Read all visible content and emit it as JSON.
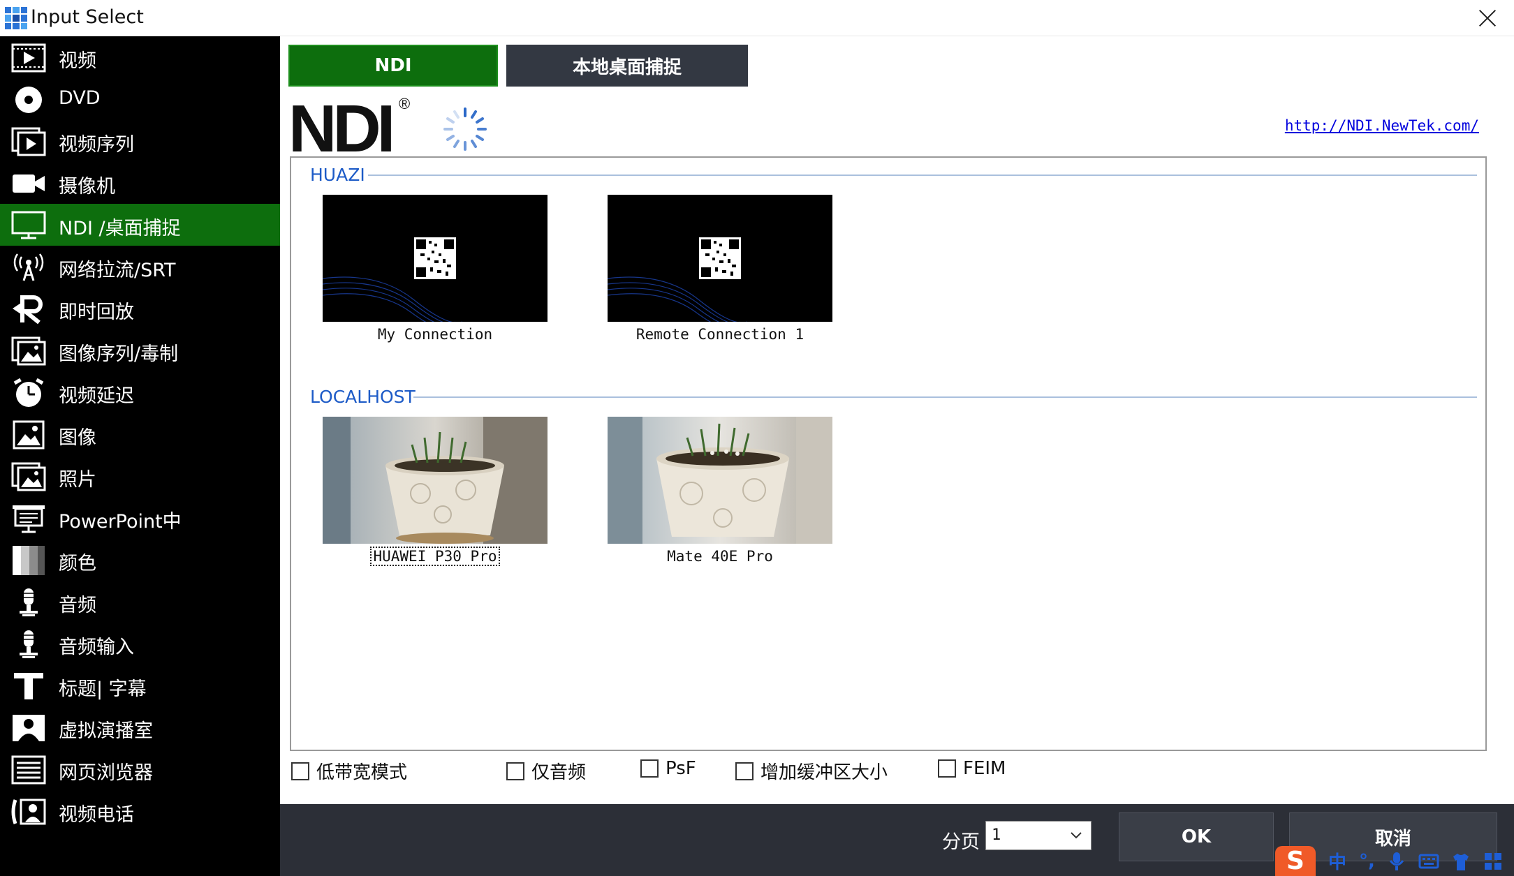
{
  "window": {
    "title": "Input Select"
  },
  "sidebar": {
    "items": [
      {
        "label": "视频",
        "icon": "video-icon"
      },
      {
        "label": "DVD",
        "icon": "disc-icon"
      },
      {
        "label": "视频序列",
        "icon": "video-list-icon"
      },
      {
        "label": "摄像机",
        "icon": "camera-icon"
      },
      {
        "label": "NDI /桌面捕捉",
        "icon": "monitor-icon",
        "active": true
      },
      {
        "label": "网络拉流/SRT",
        "icon": "antenna-icon"
      },
      {
        "label": "即时回放",
        "icon": "replay-icon"
      },
      {
        "label": "图像序列/毒制",
        "icon": "image-sequence-icon"
      },
      {
        "label": "视频延迟",
        "icon": "timer-icon"
      },
      {
        "label": "图像",
        "icon": "image-icon"
      },
      {
        "label": "照片",
        "icon": "photos-icon"
      },
      {
        "label": "PowerPoint中",
        "icon": "presentation-icon"
      },
      {
        "label": "颜色",
        "icon": "color-icon"
      },
      {
        "label": "音频",
        "icon": "microphone-icon"
      },
      {
        "label": "音频输入",
        "icon": "microphone-input-icon"
      },
      {
        "label": "标题| 字幕",
        "icon": "title-icon"
      },
      {
        "label": "虚拟演播室",
        "icon": "virtual-studio-icon"
      },
      {
        "label": "网页浏览器",
        "icon": "browser-icon"
      },
      {
        "label": "视频电话",
        "icon": "video-call-icon"
      }
    ]
  },
  "tabs": {
    "ndi": "NDI",
    "desktop": "本地桌面捕捉"
  },
  "ndi_header": {
    "logo": "NDI",
    "reg": "®",
    "link": "http://NDI.NewTek.com/"
  },
  "groups": [
    {
      "name": "HUAZI",
      "sources": [
        {
          "label": "My Connection"
        },
        {
          "label": "Remote Connection 1"
        }
      ]
    },
    {
      "name": "LOCALHOST",
      "sources": [
        {
          "label": "HUAWEI P30 Pro"
        },
        {
          "label": "Mate 40E Pro"
        }
      ]
    }
  ],
  "options": [
    {
      "label": "低带宽模式",
      "checked": false
    },
    {
      "label": "仅音频",
      "checked": false
    },
    {
      "label": "PsF",
      "checked": false
    },
    {
      "label": "增加缓冲区大小",
      "checked": false
    },
    {
      "label": "FEIM",
      "checked": false
    }
  ],
  "bottom": {
    "page_label": "分页",
    "page_value": "1",
    "ok": "OK",
    "cancel": "取消"
  },
  "ime": {
    "logo": "S",
    "lang": "中",
    "punct": "°,"
  },
  "colors": {
    "accent_green": "#0d6e0d",
    "link_blue": "#0000dd",
    "group_blue": "#1d5bc7",
    "bottom_bar": "#2c2f37"
  }
}
